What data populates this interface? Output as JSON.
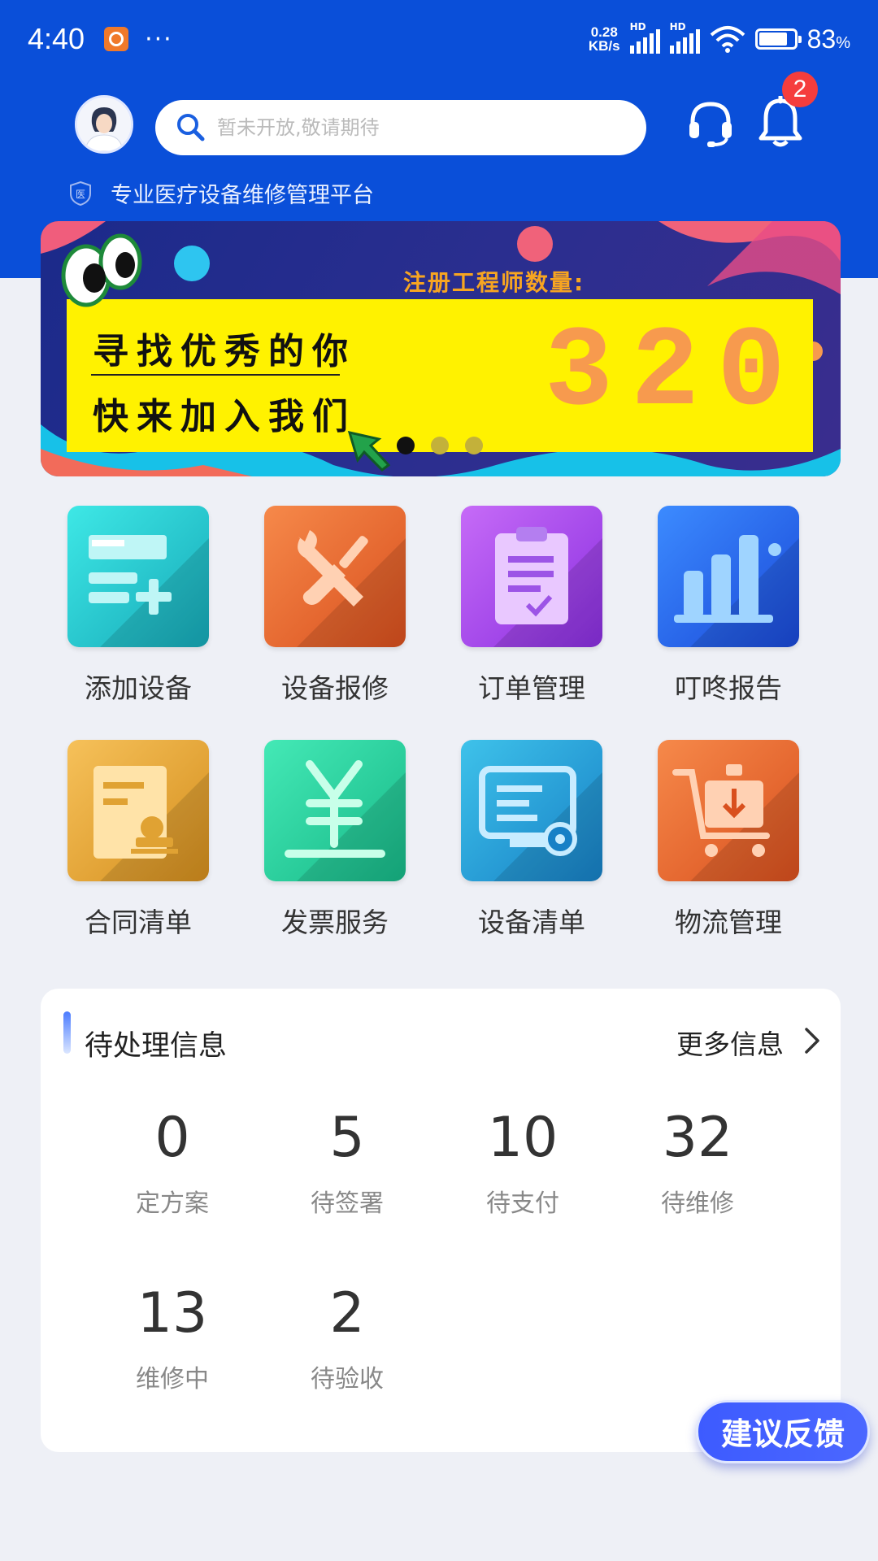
{
  "status": {
    "time": "4:40",
    "more": "···",
    "speed_value": "0.28",
    "speed_unit": "KB/s",
    "hd1": "HD",
    "hd2": "HD",
    "battery_percent": "83",
    "percent_sign": "%",
    "battery_level": 83
  },
  "header": {
    "search_placeholder": "暂未开放,敬请期待",
    "bell_badge": "2",
    "slogan": "专业医疗设备维修管理平台",
    "slogan_badge": "医"
  },
  "banner": {
    "line1": "寻找优秀的你",
    "line2": "快来加入我们",
    "reg_label": "注册工程师数量:",
    "count": "320",
    "slide_count": 3,
    "active_slide": 0
  },
  "menu": {
    "items": [
      {
        "label": "添加设备",
        "icon": "add-device-icon",
        "color_from": "#3ee8e6",
        "color_to": "#16a9b8"
      },
      {
        "label": "设备报修",
        "icon": "repair-tools-icon",
        "color_from": "#f6894a",
        "color_to": "#d9501e"
      },
      {
        "label": "订单管理",
        "icon": "clipboard-check-icon",
        "color_from": "#c66bf7",
        "color_to": "#8a2fe0"
      },
      {
        "label": "叮咚报告",
        "icon": "bar-chart-icon",
        "color_from": "#3c8bff",
        "color_to": "#1a49d8"
      },
      {
        "label": "合同清单",
        "icon": "contract-stamp-icon",
        "color_from": "#f6c15a",
        "color_to": "#d48e1d"
      },
      {
        "label": "发票服务",
        "icon": "yen-invoice-icon",
        "color_from": "#44e9b6",
        "color_to": "#17b887"
      },
      {
        "label": "设备清单",
        "icon": "device-list-icon",
        "color_from": "#3ec2ea",
        "color_to": "#1780c6"
      },
      {
        "label": "物流管理",
        "icon": "cart-icon",
        "color_from": "#f6894a",
        "color_to": "#d9501e"
      }
    ]
  },
  "pending": {
    "title": "待处理信息",
    "more": "更多信息",
    "stats": [
      {
        "num": "0",
        "label": "定方案"
      },
      {
        "num": "5",
        "label": "待签署"
      },
      {
        "num": "10",
        "label": "待支付"
      },
      {
        "num": "32",
        "label": "待维修"
      },
      {
        "num": "13",
        "label": "维修中"
      },
      {
        "num": "2",
        "label": "待验收"
      }
    ]
  },
  "feedback": {
    "label": "建议反馈"
  },
  "colors": {
    "brand_blue": "#0a4fd9",
    "page_bg": "#eef0f6",
    "badge_red": "#f53d3d",
    "banner_yellow": "#fff200"
  }
}
